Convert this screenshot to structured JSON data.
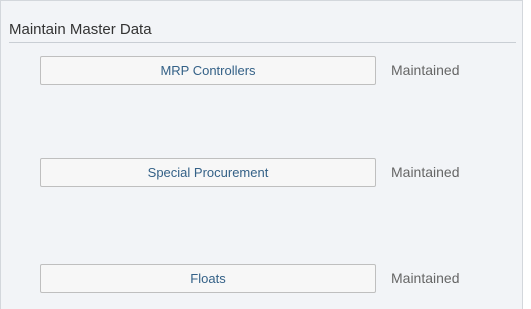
{
  "section": {
    "title": "Maintain Master Data"
  },
  "rows": [
    {
      "button_label": "MRP Controllers",
      "status": "Maintained"
    },
    {
      "button_label": "Special Procurement",
      "status": "Maintained"
    },
    {
      "button_label": "Floats",
      "status": "Maintained"
    }
  ],
  "colors": {
    "panel_bg": "#f2f4f7",
    "button_text": "#346187",
    "status_text": "#666666"
  }
}
